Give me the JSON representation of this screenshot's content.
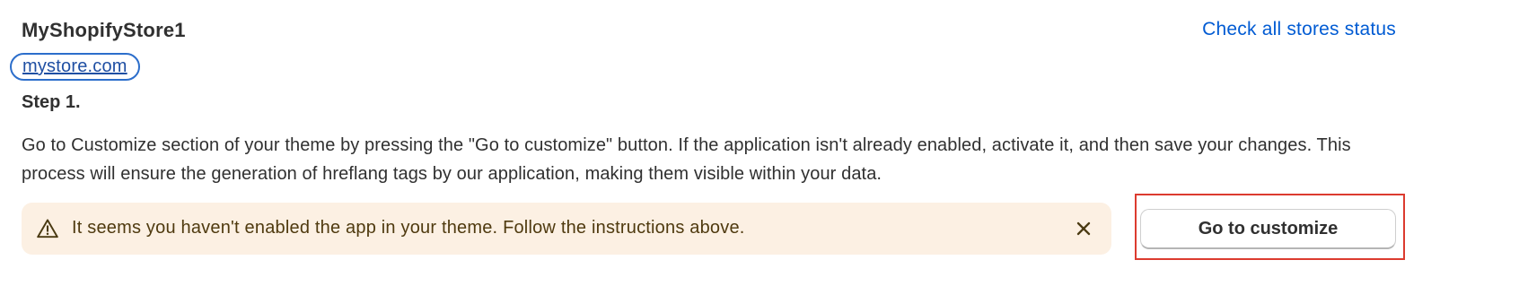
{
  "store": {
    "name": "MyShopifyStore1",
    "url": "mystore.com"
  },
  "header": {
    "status_link": "Check all stores status"
  },
  "step": {
    "title": "Step 1.",
    "instructions": "Go to Customize section of your theme by pressing the \"Go to customize\" button. If the application isn't already enabled, activate it, and then save your changes. This process will ensure the generation of hreflang tags by our application, making them visible within your data."
  },
  "warning": {
    "icon": "alert-triangle-icon",
    "message": "It seems you haven't enabled the app in your theme. Follow the instructions above.",
    "dismiss_icon": "close-icon"
  },
  "actions": {
    "customize_label": "Go to customize"
  },
  "colors": {
    "link": "#005bd3",
    "warning_bg": "#fcf0e3",
    "warning_text": "#4f3a0f",
    "highlight_border": "#dc3b2f",
    "focus_ring": "#2c6ecb"
  }
}
